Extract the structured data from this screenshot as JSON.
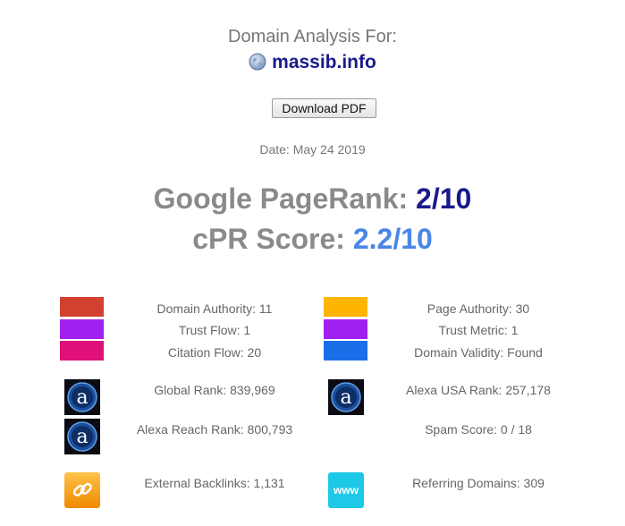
{
  "header": {
    "title": "Domain Analysis For:",
    "domain": "massib.info",
    "download_label": "Download PDF",
    "date": "Date: May 24 2019"
  },
  "scores": {
    "pagerank_label": "Google PageRank: ",
    "pagerank_value": "2/10",
    "cpr_label": "cPR Score: ",
    "cpr_value": "2.2/10"
  },
  "metrics_left": [
    {
      "label": "Domain Authority: 11",
      "color": "#d24030"
    },
    {
      "label": "Trust Flow: 1",
      "color": "#a020f0"
    },
    {
      "label": "Citation Flow: 20",
      "color": "#e0107a"
    }
  ],
  "metrics_right": [
    {
      "label": "Page Authority: 30",
      "color": "#ffb400"
    },
    {
      "label": "Trust Metric: 1",
      "color": "#a020f0"
    },
    {
      "label": "Domain Validity: Found",
      "color": "#1a6fe8"
    }
  ],
  "ranks": {
    "global_rank": "Global Rank: 839,969",
    "usa_rank": "Alexa USA Rank: 257,178",
    "reach_rank": "Alexa Reach Rank: 800,793",
    "spam_score": "Spam Score: 0 / 18"
  },
  "links": {
    "external_backlinks": "External Backlinks: 1,131",
    "referring_domains": "Referring Domains: 309",
    "www_text": "www"
  },
  "icons": {
    "globe": "globe-icon",
    "alexa": "alexa-icon",
    "chain": "chain-link-icon",
    "www": "www-icon"
  }
}
